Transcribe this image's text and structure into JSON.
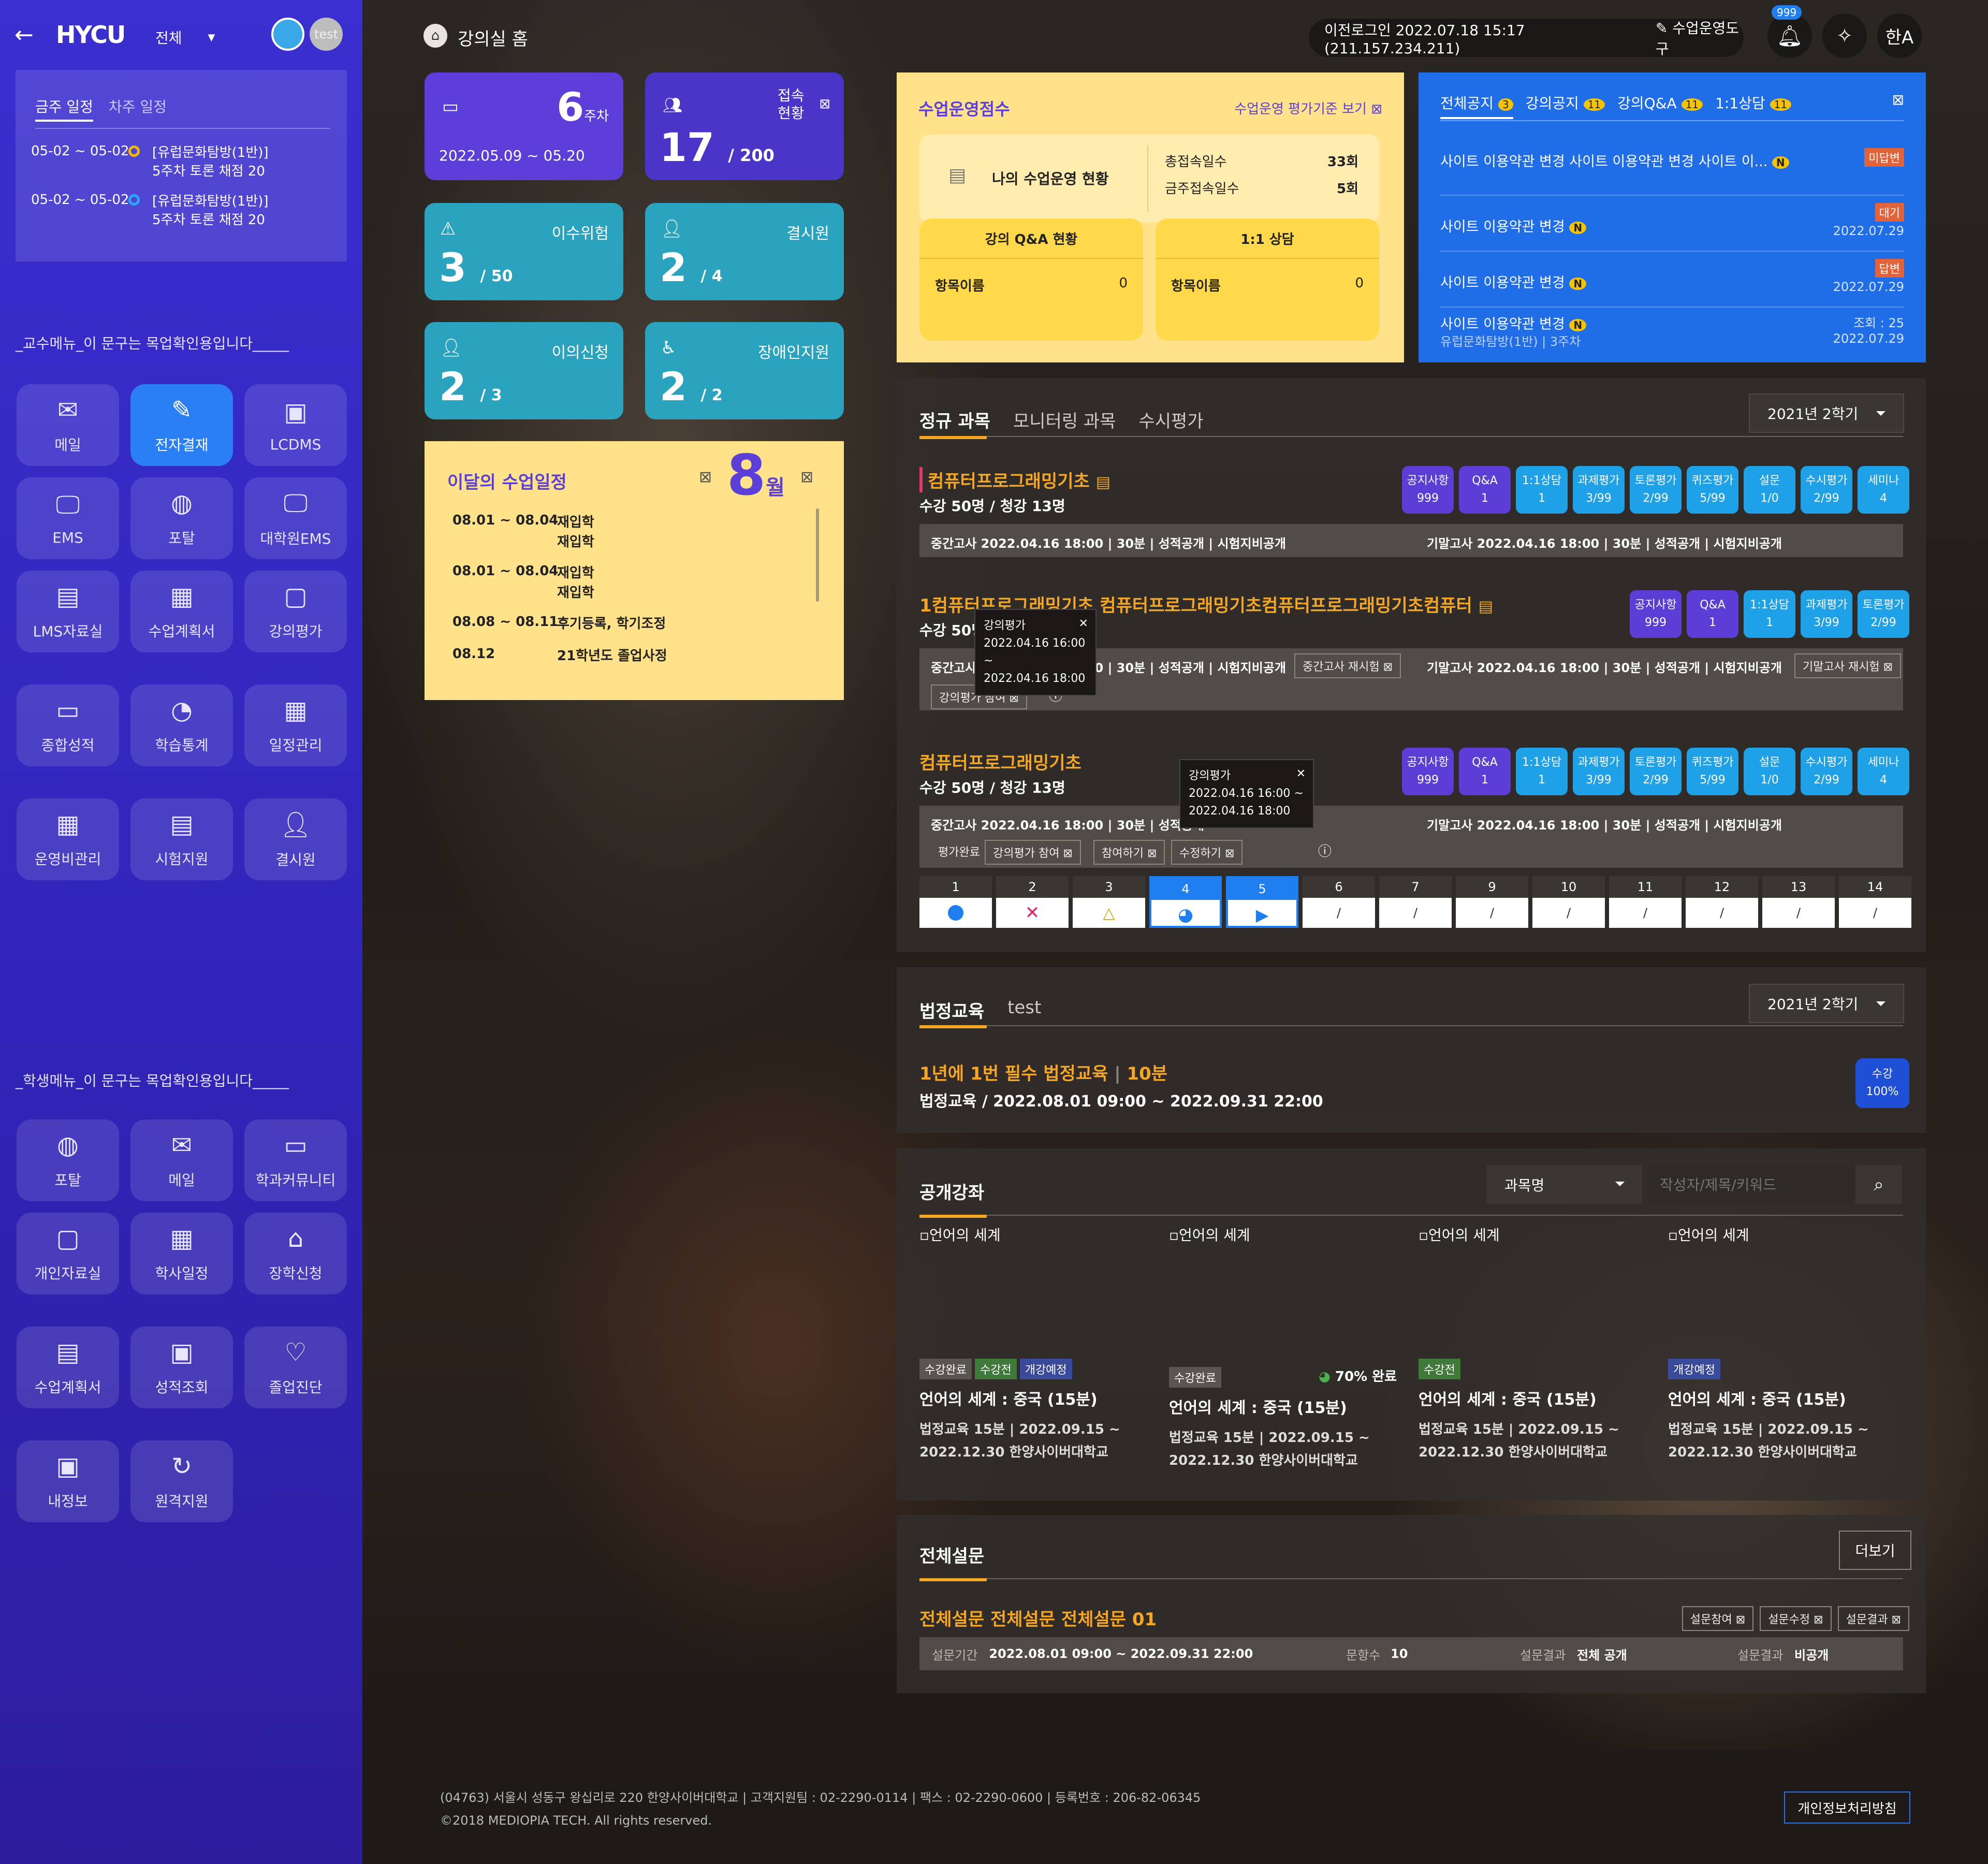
{
  "sidebar": {
    "logo": "HYCU",
    "scope": "전체",
    "user": "test",
    "sched_tabs": [
      "금주 일정",
      "차주 일정"
    ],
    "schedule": [
      {
        "date": "05-02 ~ 05-02",
        "title": "[유럽문화탐방(1반)]",
        "desc": "5주차 토론 채점 20"
      },
      {
        "date": "05-02 ~ 05-02",
        "title": "[유럽문화탐방(1반)]",
        "desc": "5주차 토론 채점 20"
      }
    ],
    "prof_heading": "_교수메뉴_이 문구는 목업확인용입니다_____",
    "prof_menu": [
      "메일",
      "전자결재",
      "LCDMS",
      "EMS",
      "포탈",
      "대학원EMS",
      "LMS자료실",
      "수업계획서",
      "강의평가",
      "종합성적",
      "학습통계",
      "일정관리",
      "운영비관리",
      "시험지원",
      "결시원"
    ],
    "stu_heading": "_학생메뉴_이 문구는 목업확인용입니다_____",
    "stu_menu": [
      "포탈",
      "메일",
      "학과커뮤니티",
      "개인자료실",
      "학사일정",
      "장학신청",
      "수업계획서",
      "성적조회",
      "졸업진단",
      "내정보",
      "원격지원"
    ]
  },
  "header": {
    "title": "강의실 홈",
    "last_login": "이전로그인 2022.07.18 15:17 (211.157.234.211)",
    "tool": "수업운영도구",
    "notif_count": "999",
    "lang": "한A"
  },
  "stats": {
    "week": {
      "num": "6",
      "unit": "주차",
      "range": "2022.05.09 ~ 05.20"
    },
    "access": {
      "label": "접속\n현황",
      "num": "17",
      "total": "/ 200"
    },
    "risk": {
      "label": "이수위험",
      "num": "3",
      "total": "/ 50"
    },
    "absent": {
      "label": "결시원",
      "num": "2",
      "total": "/ 4"
    },
    "objection": {
      "label": "이의신청",
      "num": "2",
      "total": "/ 3"
    },
    "disabled": {
      "label": "장애인지원",
      "num": "2",
      "total": "/ 2"
    }
  },
  "monthly": {
    "title": "이달의 수업일정",
    "month": "8",
    "month_unit": "월",
    "items": [
      {
        "date": "08.01 ~ 08.04",
        "text": "재입학\n재입학"
      },
      {
        "date": "08.01 ~ 08.04",
        "text": "재입학\n재입학"
      },
      {
        "date": "08.08 ~ 08.11",
        "text": "후기등록, 학기조정"
      },
      {
        "date": "08.12",
        "text": "21학년도 졸업사정"
      }
    ]
  },
  "score": {
    "title": "수업운영점수",
    "link": "수업운영 평가기준 보기",
    "my": "나의 수업운영 현황",
    "total_label": "총접속일수",
    "total_val": "33회",
    "week_label": "금주접속일수",
    "week_val": "5회",
    "qa_title": "강의 Q&A 현황",
    "qa_item": "항목이름",
    "qa_val": "0",
    "c_title": "1:1 상담",
    "c_item": "항목이름",
    "c_val": "0"
  },
  "notices": {
    "tabs": [
      {
        "label": "전체공지",
        "n": "3"
      },
      {
        "label": "강의공지",
        "n": "11"
      },
      {
        "label": "강의Q&A",
        "n": "11"
      },
      {
        "label": "1:1상담",
        "n": "11"
      }
    ],
    "items": [
      {
        "title": "사이트 이용약관 변경 사이트 이용약관 변경 사이트 이...",
        "badge": "미답변",
        "date": ""
      },
      {
        "title": "사이트 이용약관 변경",
        "badge": "대기",
        "date": "2022.07.29"
      },
      {
        "title": "사이트 이용약관 변경",
        "badge": "답변",
        "date": "2022.07.29"
      },
      {
        "title": "사이트 이용약관 변경",
        "badge": "",
        "sub": "유럽문화탐방(1반)  |  3주차",
        "views": "조회 : 25",
        "date": "2022.07.29"
      }
    ]
  },
  "courses": {
    "tabs": [
      "정규 과목",
      "모니터링 과목",
      "수시평가"
    ],
    "term": "2021년 2학기",
    "list": [
      {
        "title": "컴퓨터프로그래밍기초",
        "info": "수강 50명 / 청강 13명",
        "tags": [
          [
            "공지사항",
            "999"
          ],
          [
            "Q&A",
            "1"
          ],
          [
            "1:1상담",
            "1"
          ],
          [
            "과제평가",
            "3/99"
          ],
          [
            "토론평가",
            "2/99"
          ],
          [
            "퀴즈평가",
            "5/99"
          ],
          [
            "설문",
            "1/0"
          ],
          [
            "수시평가",
            "2/99"
          ],
          [
            "세미나",
            "4"
          ]
        ],
        "mid": "중간고사   2022.04.16 18:00  |  30분  |  성적공개  |  시험지비공개",
        "fin": "기말고사   2022.04.16 18:00  |  30분  |  성적공개  |  시험지비공개"
      },
      {
        "title": "1컴퓨터프로그래밍기초 컴퓨터프로그래밍기초컴퓨터프로그래밍기초컴퓨터",
        "info": "수강 50명 / 청강 13명",
        "tags": [
          [
            "공지사항",
            "999"
          ],
          [
            "Q&A",
            "1"
          ],
          [
            "1:1상담",
            "1"
          ],
          [
            "과제평가",
            "3/99"
          ],
          [
            "토론평가",
            "2/99"
          ]
        ],
        "mid": "중간고사   2022.04.16 18:00  |  30분  |  성적공개  |  시험지비공개",
        "mid_btn": "중간고사 재시험",
        "fin": "기말고사   2022.04.16 18:00  |  30분  |  성적공개  |  시험지비공개",
        "fin_btn": "기말고사 재시험",
        "eval_btn": "강의평가 참여"
      },
      {
        "title": "컴퓨터프로그래밍기초",
        "info": "수강 50명 / 청강 13명",
        "tags": [
          [
            "공지사항",
            "999"
          ],
          [
            "Q&A",
            "1"
          ],
          [
            "1:1상담",
            "1"
          ],
          [
            "과제평가",
            "3/99"
          ],
          [
            "토론평가",
            "2/99"
          ],
          [
            "퀴즈평가",
            "5/99"
          ],
          [
            "설문",
            "1/0"
          ],
          [
            "수시평가",
            "2/99"
          ],
          [
            "세미나",
            "4"
          ]
        ],
        "mid": "중간고사   2022.04.16 18:00  |  30분  |  성적공개",
        "fin": "기말고사   2022.04.16 18:00  |  30분  |  성적공개  |  시험지비공개",
        "btns": [
          "평가완료",
          "강의평가 참여",
          "참여하기",
          "수정하기"
        ]
      }
    ],
    "tip": {
      "title": "강의평가",
      "l1": "2022.04.16 16:00 ~",
      "l2": "2022.04.16 18:00"
    },
    "weeks": [
      "1",
      "2",
      "3",
      "4",
      "5",
      "6",
      "7",
      "9",
      "10",
      "11",
      "12",
      "13",
      "14"
    ]
  },
  "legal": {
    "tabs": [
      "법정교육",
      "test"
    ],
    "term": "2021년 2학기",
    "title": "1년에 1번 필수 법정교육",
    "dur": "10분",
    "info": "법정교육 / 2022.08.01 09:00 ~ 2022.09.31 22:00",
    "badge": "수강\n100%"
  },
  "open": {
    "title": "공개강좌",
    "select": "과목명",
    "placeholder": "작성자/제목/키워드",
    "items": [
      {
        "img": "언어의 세계",
        "pills": [
          "수강완료",
          "수강전",
          "개강예정"
        ],
        "title": "언어의 세계 : 중국 (15분)",
        "l1": "법정교육 15분  |  2022.09.15 ~",
        "l2": "2022.12.30 한양사이버대학교"
      },
      {
        "img": "언어의 세계",
        "pills": [
          "수강완료"
        ],
        "progress": "70% 완료",
        "title": "언어의 세계 : 중국 (15분)",
        "l1": "법정교육 15분  |  2022.09.15 ~",
        "l2": "2022.12.30 한양사이버대학교"
      },
      {
        "img": "언어의 세계",
        "pills": [
          "수강전"
        ],
        "title": "언어의 세계 : 중국 (15분)",
        "l1": "법정교육 15분  |  2022.09.15 ~",
        "l2": "2022.12.30 한양사이버대학교"
      },
      {
        "img": "언어의 세계",
        "pills": [
          "개강예정"
        ],
        "title": "언어의 세계 : 중국 (15분)",
        "l1": "법정교육 15분  |  2022.09.15 ~",
        "l2": "2022.12.30 한양사이버대학교"
      }
    ]
  },
  "survey": {
    "title": "전체설문",
    "more": "더보기",
    "name": "전체설문 전체설문 전체설문 01",
    "btns": [
      "설문참여",
      "설문수정",
      "설문결과"
    ],
    "period_label": "설문기간",
    "period": "2022.08.01 09:00 ~ 2022.09.31 22:00",
    "q_label": "문항수",
    "q": "10",
    "r1_label": "설문결과",
    "r1": "전체 공개",
    "r2_label": "설문결과",
    "r2": "비공개"
  },
  "footer": {
    "addr": "(04763) 서울시 성동구 왕십리로 220 한양사이버대학교  |  고객지원팀 : 02-2290-0114  |  팩스 : 02-2290-0600  |  등록번호 : 206-82-06345",
    "copy": "©2018 MEDIOPIA TECH. All rights reserved.",
    "privacy": "개인정보처리방침"
  },
  "colors": {
    "sidebar": "#3a2fd0",
    "purple": "#5b3fd8",
    "blue": "#1f6ee8",
    "teal": "#2aa3be",
    "yellow": "#ffe28a",
    "orange": "#f5a623"
  }
}
